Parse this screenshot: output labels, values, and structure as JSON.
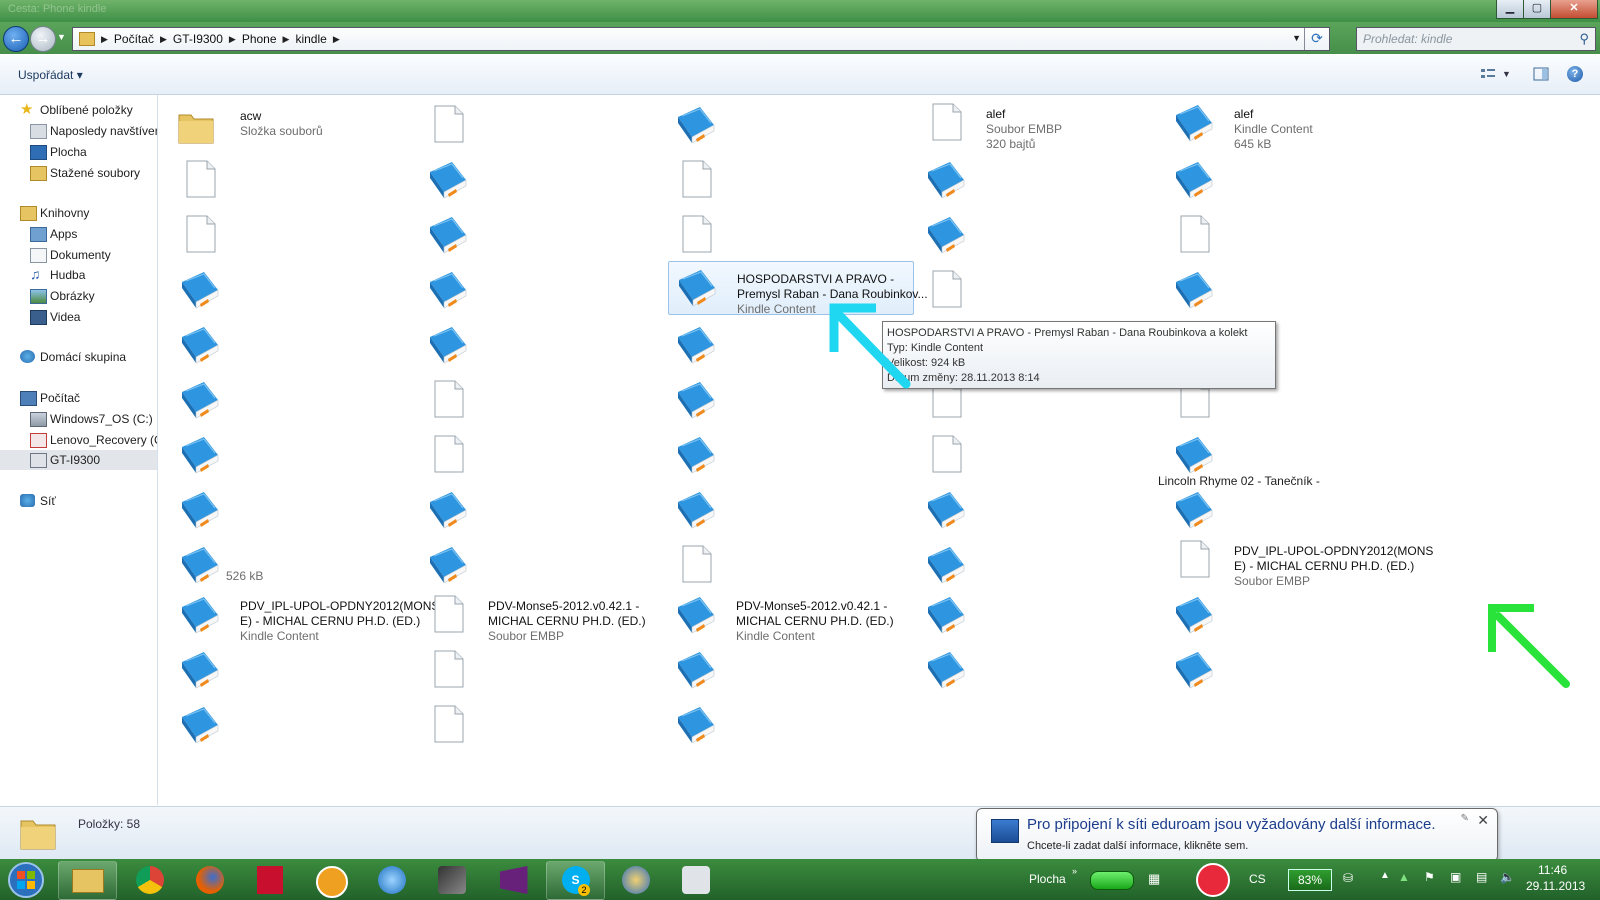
{
  "window": {
    "title": "Cesta: Phone kindle",
    "buttons": {
      "minimize": "▁",
      "maximize": "▢",
      "close": "✕"
    }
  },
  "address": {
    "crumbs": [
      "Počítač",
      "GT-I9300",
      "Phone",
      "kindle"
    ],
    "search_placeholder": "Prohledat: kindle"
  },
  "toolbar": {
    "organize": "Uspořádat"
  },
  "sidebar": {
    "favorites": "Oblíbené položky",
    "fav_items": [
      "Naposledy navštíver",
      "Plocha",
      "Stažené soubory"
    ],
    "libraries": "Knihovny",
    "lib_items": [
      "Apps",
      "Dokumenty",
      "Hudba",
      "Obrázky",
      "Videa"
    ],
    "homegroup": "Domácí skupina",
    "computer": "Počítač",
    "comp_items": [
      "Windows7_OS (C:)",
      "Lenovo_Recovery (C",
      "GT-I9300"
    ],
    "network": "Síť"
  },
  "files": {
    "acw": {
      "name": "acw",
      "type": "Složka souborů"
    },
    "alef_embp": {
      "name": "alef",
      "type": "Soubor EMBP",
      "size": "320 bajtů"
    },
    "alef_kindle": {
      "name": "alef",
      "type": "Kindle Content",
      "size": "645 kB"
    },
    "hosp": {
      "line1": "HOSPODARSTVI A PRAVO -",
      "line2": "Premysl Raban - Dana Roubinkov...",
      "type": "Kindle Content"
    },
    "size526": "526 kB",
    "pdv_kindle": {
      "line1": "PDV_IPL-UPOL-OPDNY2012(MONS",
      "line2": "E) - MICHAL CERNU PH.D. (ED.)",
      "type": "Kindle Content"
    },
    "pdv_embp": {
      "line1": "PDV_IPL-UPOL-OPDNY2012(MONS",
      "line2": "E) - MICHAL CERNU PH.D. (ED.)",
      "type": "Soubor EMBP"
    },
    "monse_embp": {
      "line1": "PDV-Monse5-2012.v0.42.1 -",
      "line2": "MICHAL CERNU PH.D. (ED.)",
      "type": "Soubor EMBP"
    },
    "monse_kindle": {
      "line1": "PDV-Monse5-2012.v0.42.1 -",
      "line2": "MICHAL CERNU PH.D. (ED.)",
      "type": "Kindle Content"
    },
    "lincoln": "Lincoln Rhyme 02 - Tanečník -"
  },
  "tooltip": {
    "line1": "HOSPODARSTVI A PRAVO - Premysl Raban - Dana Roubinkova a kolekt",
    "line2": "Typ: Kindle Content",
    "line3": "Velikost: 924 kB",
    "line4": "Datum změny: 28.11.2013 8:14"
  },
  "details": {
    "count": "Položky: 58"
  },
  "balloon": {
    "title": "Pro připojení k síti eduroam jsou vyžadovány další informace.",
    "text": "Chcete-li zadat další informace, klikněte sem."
  },
  "taskbar": {
    "desktop_label": "Plocha",
    "language": "CS",
    "battery": "83%",
    "time": "11:46",
    "date": "29.11.2013",
    "skype_badge": "2"
  },
  "colors": {
    "arrow_cyan": "#1fd7f0",
    "arrow_green": "#29e23a",
    "book_blue": "#1e88d6"
  }
}
